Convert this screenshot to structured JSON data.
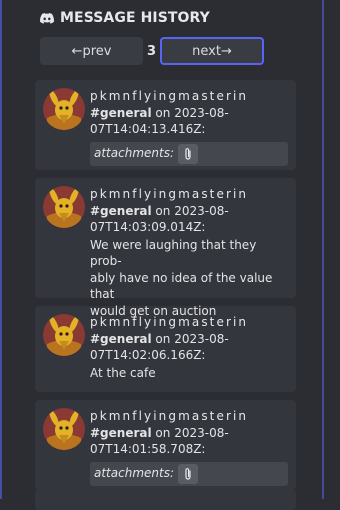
{
  "header": {
    "title": "MESSAGE HISTORY",
    "icon": "discord-icon"
  },
  "pager": {
    "prev_label": "←prev",
    "page": "3",
    "next_label": "next→"
  },
  "colors": {
    "background": "#2b2d33",
    "card": "#34363d",
    "accent": "#5865f2"
  },
  "messages": [
    {
      "author": "pkmnflyingmasterin",
      "channel": "#general",
      "on": "on",
      "timestamp_line1": "2023-08-",
      "timestamp_line2": "07T14:04:13.416Z:",
      "attachments_label": "attachments:"
    },
    {
      "author": "pkmnflyingmasterin",
      "channel": "#general",
      "on": "on",
      "timestamp_line1": "2023-08-",
      "timestamp_line2": "07T14:03:09.014Z:",
      "text_lines": [
        "We were laughing that they prob-",
        "ably have no idea of the value that",
        "would get on auction"
      ]
    },
    {
      "author": "pkmnflyingmasterin",
      "channel": "#general",
      "on": "on",
      "timestamp_line1": "2023-08-",
      "timestamp_line2": "07T14:02:06.166Z:",
      "text_lines": [
        "At the cafe"
      ]
    },
    {
      "author": "pkmnflyingmasterin",
      "channel": "#general",
      "on": "on",
      "timestamp_line1": "2023-08-",
      "timestamp_line2": "07T14:01:58.708Z:",
      "attachments_label": "attachments:"
    }
  ]
}
